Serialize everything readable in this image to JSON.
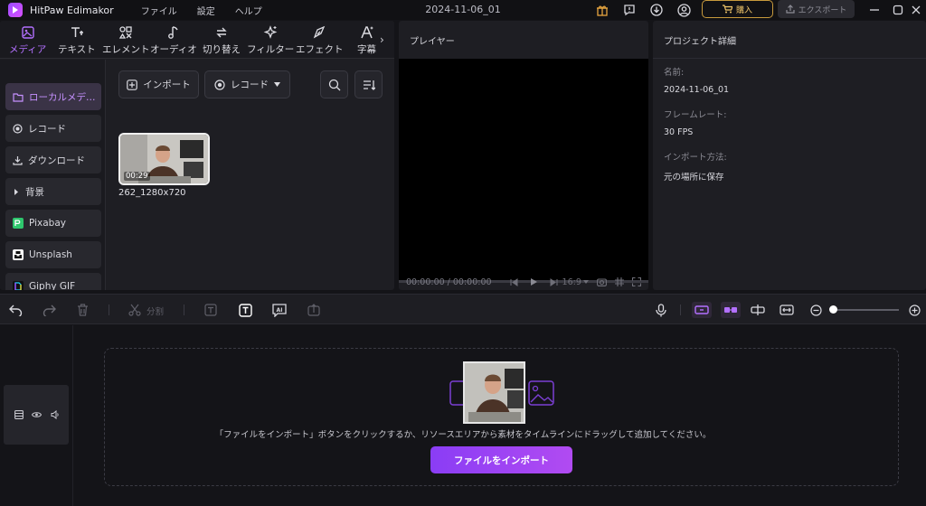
{
  "app": {
    "name": "HitPaw Edimakor",
    "document_title": "2024-11-06_01"
  },
  "menu": {
    "file": "ファイル",
    "settings": "設定",
    "help": "ヘルプ"
  },
  "titlebar": {
    "buy_label": "購入",
    "export_label": "エクスポート"
  },
  "media_tabs": [
    {
      "label": "メディア",
      "icon": "media-icon"
    },
    {
      "label": "テキスト",
      "icon": "text-icon"
    },
    {
      "label": "エレメント",
      "icon": "element-icon"
    },
    {
      "label": "オーディオ",
      "icon": "audio-icon"
    },
    {
      "label": "切り替え",
      "icon": "transition-icon"
    },
    {
      "label": "フィルター",
      "icon": "filter-icon"
    },
    {
      "label": "エフェクト",
      "icon": "effect-icon"
    },
    {
      "label": "字幕",
      "icon": "subtitle-icon"
    }
  ],
  "sidebar": [
    {
      "label": "ローカルメデ…",
      "icon": "folder-icon"
    },
    {
      "label": "レコード",
      "icon": "record-icon"
    },
    {
      "label": "ダウンロード",
      "icon": "download-icon"
    },
    {
      "label": "背景",
      "icon": "caret-right-icon"
    },
    {
      "label": "Pixabay",
      "icon": "pixabay-icon"
    },
    {
      "label": "Unsplash",
      "icon": "unsplash-icon"
    },
    {
      "label": "Giphy GIF",
      "icon": "giphy-icon"
    }
  ],
  "media_controls": {
    "import_label": "インポート",
    "record_label": "レコード"
  },
  "media_items": [
    {
      "name": "262_1280x720",
      "duration": "00:29"
    }
  ],
  "player": {
    "title": "プレイヤー",
    "time_current": "00:00:00",
    "time_separator": "/",
    "time_total": "00:00:00",
    "aspect_ratio": "16:9"
  },
  "project": {
    "title": "プロジェクト詳細",
    "name_label": "名前:",
    "name_value": "2024-11-06_01",
    "framerate_label": "フレームレート:",
    "framerate_value": "30 FPS",
    "import_method_label": "インポート方法:",
    "import_method_value": "元の場所に保存"
  },
  "timeline_toolbar": {
    "split_label": "分割"
  },
  "timeline": {
    "drop_hint": "「ファイルをインポート」ボタンをクリックするか、リソースエリアから素材をタイムラインにドラッグして追加してください。",
    "import_button": "ファイルをインポート"
  },
  "colors": {
    "accent": "#a95cff",
    "buy": "#f1c66a",
    "import_gradient_start": "#8a3df5",
    "import_gradient_end": "#b14bf2"
  }
}
